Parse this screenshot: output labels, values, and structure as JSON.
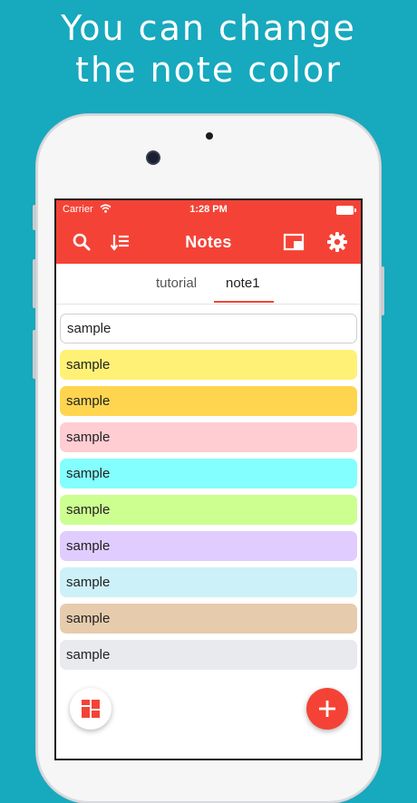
{
  "promo": {
    "line1": "You can change",
    "line2": "the note color"
  },
  "status_bar": {
    "carrier": "Carrier",
    "time": "1:28 PM",
    "wifi_icon": "wifi-icon",
    "battery_icon": "battery-icon"
  },
  "toolbar": {
    "title": "Notes",
    "icons": [
      "search-icon",
      "sort-icon",
      "window-icon",
      "gear-icon"
    ]
  },
  "tabs": [
    {
      "label": "tutorial",
      "active": false
    },
    {
      "label": "note1",
      "active": true
    }
  ],
  "notes": [
    {
      "text": "sample",
      "color": "#ffffff"
    },
    {
      "text": "sample",
      "color": "#fff176"
    },
    {
      "text": "sample",
      "color": "#ffd54f"
    },
    {
      "text": "sample",
      "color": "#ffcdd2"
    },
    {
      "text": "sample",
      "color": "#84ffff"
    },
    {
      "text": "sample",
      "color": "#ccff90"
    },
    {
      "text": "sample",
      "color": "#e1ccff"
    },
    {
      "text": "sample",
      "color": "#cdf1f8"
    },
    {
      "text": "sample",
      "color": "#e6ccad"
    },
    {
      "text": "sample",
      "color": "#e8eaed"
    }
  ],
  "fabs": {
    "left_icon": "grid-icon",
    "right_icon": "plus-icon"
  },
  "colors": {
    "background": "#17a9be",
    "accent": "#f44336"
  }
}
